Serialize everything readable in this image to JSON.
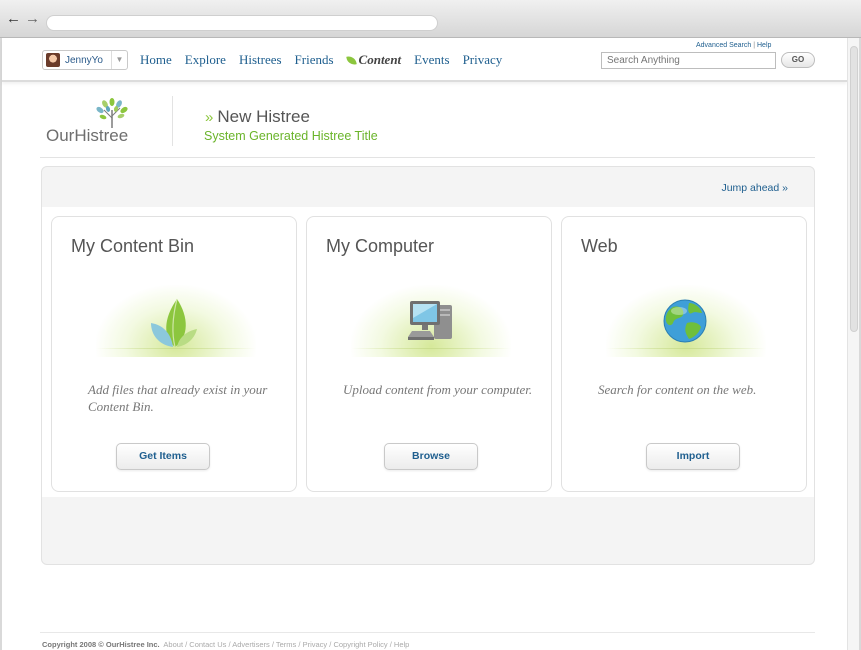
{
  "header": {
    "user": {
      "name": "JennyYo"
    },
    "nav": [
      {
        "label": "Home"
      },
      {
        "label": "Explore"
      },
      {
        "label": "Histrees"
      },
      {
        "label": "Friends"
      },
      {
        "label": "Content"
      },
      {
        "label": "Events"
      },
      {
        "label": "Privacy"
      }
    ],
    "active_nav": "Content",
    "top_links": {
      "advanced_search": "Advanced Search",
      "separator": "|",
      "help": "Help"
    },
    "search": {
      "placeholder": "Search Anything",
      "go_label": "GO"
    }
  },
  "logo": {
    "text": "OurHistree"
  },
  "title": {
    "chevron": "»",
    "main": "New Histree",
    "subtitle": "System Generated Histree Title"
  },
  "panel": {
    "jump_ahead": "Jump ahead »",
    "cards": [
      {
        "title": "My Content Bin",
        "icon": "leaf-icon",
        "description": "Add files that already exist in your Content Bin.",
        "button": "Get Items"
      },
      {
        "title": "My Computer",
        "icon": "computer-icon",
        "description": "Upload content from your computer.",
        "button": "Browse"
      },
      {
        "title": "Web",
        "icon": "globe-icon",
        "description": "Search for content on the web.",
        "button": "Import"
      }
    ]
  },
  "footer": {
    "copyright": "Copyright 2008 © OurHistree Inc.",
    "links": [
      "About",
      "Contact Us",
      "Advertisers",
      "Terms",
      "Privacy",
      "Copyright Policy",
      "Help"
    ],
    "separator": " / "
  },
  "colors": {
    "link_blue": "#1f5f8f",
    "accent_green": "#8cc63e",
    "subtitle_green": "#6ab42a"
  }
}
